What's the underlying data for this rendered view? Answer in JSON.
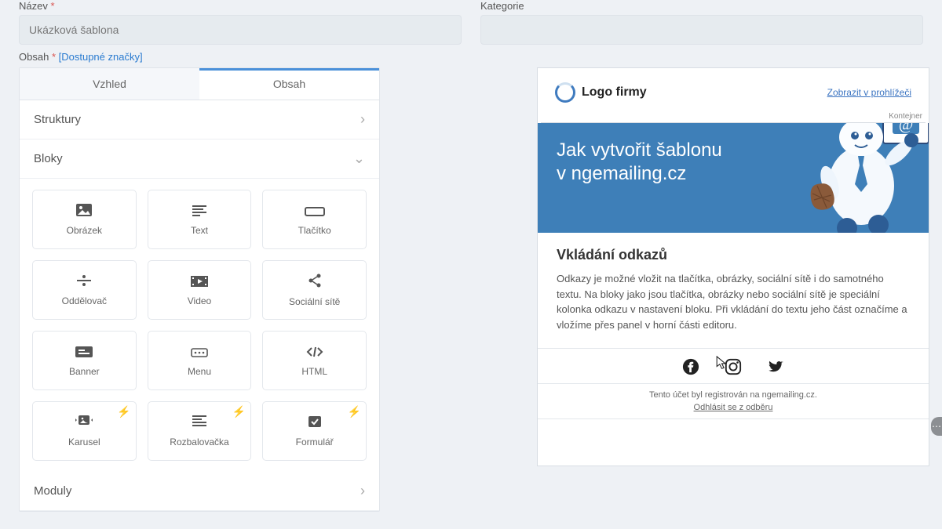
{
  "form": {
    "name_label": "Název",
    "name_value": "Ukázková šablona",
    "category_label": "Kategorie"
  },
  "obsah": {
    "label": "Obsah",
    "link": "[Dostupné značky]"
  },
  "tabs": {
    "appearance": "Vzhled",
    "content": "Obsah"
  },
  "sections": {
    "structures": "Struktury",
    "blocks": "Bloky",
    "modules": "Moduly"
  },
  "blocks": [
    {
      "name": "obrazek",
      "label": "Obrázek",
      "icon": "image",
      "bolt": false
    },
    {
      "name": "text",
      "label": "Text",
      "icon": "text",
      "bolt": false
    },
    {
      "name": "tlacitko",
      "label": "Tlačítko",
      "icon": "button",
      "bolt": false
    },
    {
      "name": "oddelovac",
      "label": "Oddělovač",
      "icon": "divider",
      "bolt": false
    },
    {
      "name": "video",
      "label": "Video",
      "icon": "video",
      "bolt": false
    },
    {
      "name": "social",
      "label": "Sociální sítě",
      "icon": "share",
      "bolt": false
    },
    {
      "name": "banner",
      "label": "Banner",
      "icon": "banner",
      "bolt": false
    },
    {
      "name": "menu",
      "label": "Menu",
      "icon": "menu",
      "bolt": false
    },
    {
      "name": "html",
      "label": "HTML",
      "icon": "code",
      "bolt": false
    },
    {
      "name": "karusel",
      "label": "Karusel",
      "icon": "carousel",
      "bolt": true
    },
    {
      "name": "rozbal",
      "label": "Rozbalovačka",
      "icon": "accordion",
      "bolt": true
    },
    {
      "name": "formular",
      "label": "Formulář",
      "icon": "checkbox",
      "bolt": true
    }
  ],
  "email": {
    "logo_text": "Logo firmy",
    "view_browser": "Zobrazit v prohlížeči",
    "container_tag": "Kontejner",
    "hero_line1": "Jak vytvořit šablonu",
    "hero_line2": "v ngemailing.cz",
    "body_title": "Vkládání odkazů",
    "body_text": "Odkazy je možné vložit na tlačítka, obrázky, sociální sítě i do samotného textu. Na bloky jako jsou tlačítka, obrázky nebo sociální sítě je speciální kolonka odkazu v nastavení bloku. Při vkládání do textu jeho část označíme a vložíme přes panel v horní části editoru.",
    "footer_line1": "Tento účet byl registrován na ngemailing.cz.",
    "footer_line2": "Odhlásit se z odběru"
  }
}
